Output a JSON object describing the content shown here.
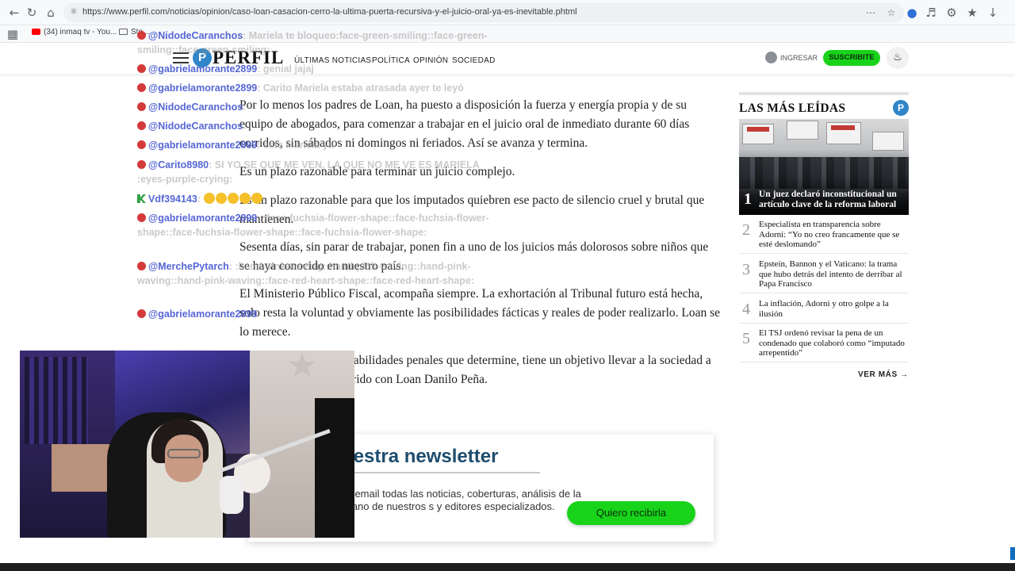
{
  "browser": {
    "url": "https://www.perfil.com/noticias/opinion/caso-loan-casacion-cerro-la-ultima-puerta-recursiva-y-el-juicio-oral-ya-es-inevitable.phtml",
    "bookmarks": [
      {
        "label": "(34) inmaq tv - You..."
      },
      {
        "label": "Sto..."
      }
    ]
  },
  "header": {
    "logo": "PERFIL",
    "logo_mark": "P",
    "nav": [
      "ÚLTIMAS NOTICIAS",
      "POLÍTICA",
      "OPINIÓN",
      "SOCIEDAD"
    ],
    "login": "INGRESAR",
    "subscribe": "SUSCRIBITE"
  },
  "article": {
    "paragraphs": [
      "Por lo menos los padres de Loan, ha puesto a disposición la fuerza y energía propia y de su equipo de abogados, para comenzar a trabajar en el juicio oral de inmediato durante 60 días corridos, sin sábados ni domingos ni feriados. Así se avanza y termina.",
      "Es un plazo razonable para terminar un juicio complejo.",
      "Es un plazo razonable para que los imputados quiebren ese pacto de silencio cruel y brutal que mantienen.",
      "Sesenta días, sin parar de trabajar, ponen fin a uno de los juicios más dolorosos sobre niños que se haya conocido en nuestro país.",
      "El Ministerio Público Fiscal, acompaña siempre. La exhortación al Tribunal futuro está hecha, solo resta la voluntad y obviamente las posibilidades fácticas y reales de poder realizarlo. Loan se lo merece.",
      "Más allá de las responsabilidades penales que determine, tiene un objetivo llevar a la sociedad a la verdad sobre lo ocurrido con Loan Danilo Peña."
    ]
  },
  "sidebar": {
    "title": "LAS MÁS LEÍDAS",
    "badge": "P",
    "items": [
      {
        "n": "1",
        "text": "Un juez declaró inconstitucional un artículo clave de la reforma laboral"
      },
      {
        "n": "2",
        "text": "Especialista en transparencia sobre Adorni: “Yo no creo francamente que se esté deslomando”"
      },
      {
        "n": "3",
        "text": "Epstein, Bannon y el Vaticano: la trama que hubo detrás del intento de derribar al Papa Francisco"
      },
      {
        "n": "4",
        "text": "La inflación, Adorni y otro golpe a la ilusión"
      },
      {
        "n": "5",
        "text": "El TSJ ordenó revisar la pena de un condenado que colaboró como “imputado arrepentido”"
      }
    ],
    "more": "VER MÁS"
  },
  "newsletter": {
    "title": "uestra newsletter",
    "description": "tu email todas las noticias, coberturas, análisis de la mano de nuestros s y editores especializados.",
    "button": "Quiero recibirla"
  },
  "chat": [
    {
      "badge": "yt",
      "user": "@NidodeCaranchos",
      "msg": ": Mariela te bloqueo:face-green-smiling::face-green-smiling::face-green-smiling:"
    },
    {
      "badge": "yt",
      "user": "@gabrielamorante2899",
      "msg": ": genial jajaj"
    },
    {
      "badge": "yt",
      "user": "@gabrielamorante2899",
      "msg": ": Carito Mariela estaba atrasada ayer te leyó"
    },
    {
      "badge": "yt",
      "user": "@NidodeCaranchos",
      "msg": ":"
    },
    {
      "badge": "yt",
      "user": "@NidodeCaranchos",
      "msg": ":"
    },
    {
      "badge": "yt",
      "user": "@gabrielamorante2899",
      "msg": ": esta Mariela ya"
    },
    {
      "badge": "yt",
      "user": "@Carito8980",
      "msg": ": SI YO SE QUE ME VEN, LA QUE NO ME VE ES MARIELA :eyes-purple-crying:"
    },
    {
      "badge": "mod",
      "user": "Vdf394143",
      "msg": ":",
      "emoji_count": 5
    },
    {
      "badge": "yt",
      "user": "@gabrielamorante2899",
      "msg": ": :face-fuchsia-flower-shape::face-fuchsia-flower-shape::face-fuchsia-flower-shape::face-fuchsia-flower-shape:"
    },
    {
      "badge": "yt",
      "user": "@MerchePytarch",
      "msg": ": :hand-pink-waving::hand-pink-waving::hand-pink-waving::hand-pink-waving::face-red-heart-shape::face-red-heart-shape:"
    },
    {
      "badge": "yt",
      "user": "@gabrielamorante2899",
      "msg": ""
    }
  ],
  "colors": {
    "accent_green": "#19d31a",
    "perfil_blue": "#2f86c8",
    "chat_user": "#5566d4",
    "newsletter_title": "#1f4d6e"
  }
}
